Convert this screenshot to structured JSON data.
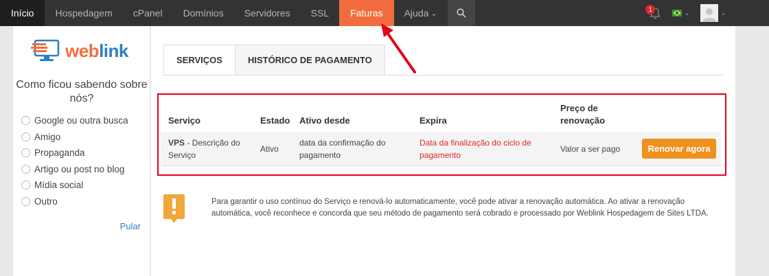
{
  "nav": {
    "items": [
      {
        "label": "Início",
        "state": "home"
      },
      {
        "label": "Hospedagem"
      },
      {
        "label": "cPanel"
      },
      {
        "label": "Domínios"
      },
      {
        "label": "Servidores"
      },
      {
        "label": "SSL"
      },
      {
        "label": "Faturas",
        "state": "active"
      },
      {
        "label": "Ajuda"
      }
    ],
    "notification_count": "1"
  },
  "sidebar": {
    "logo_prefix": "web",
    "logo_suffix": "link",
    "survey_title": "Como ficou sabendo sobre nós?",
    "options": [
      "Google ou outra busca",
      "Amigo",
      "Propaganda",
      "Artigo ou post no blog",
      "Mídia social",
      "Outro"
    ],
    "skip_label": "Pular"
  },
  "tabs": {
    "services": "SERVIÇOS",
    "payment_history": "HISTÓRICO DE PAGAMENTO"
  },
  "table": {
    "headers": {
      "service": "Serviço",
      "status": "Estado",
      "active_since": "Ativo desde",
      "expires": "Expira",
      "renewal_price": "Preço de renovação"
    },
    "row": {
      "service_name": "VPS",
      "service_desc": " - Descrição do Serviço",
      "status": "Ativo",
      "active_since": "data da confirmação do pagamento",
      "expires": "Data da finalização do ciclo de pagamento",
      "price": "Valor a ser pago",
      "renew_button": "Renovar agora"
    }
  },
  "notice": {
    "text": "Para garantir o uso contínuo do Serviço e renová-lo automaticamente, você pode ativar a renovação automática. Ao ativar a renovação automática, você reconhece e concorda que seu método de pagamento será cobrado e processado por Weblink Hospedagem de Sites LTDA."
  },
  "colors": {
    "nav_bg": "#333333",
    "active_tab": "#f26d3d",
    "highlight_border": "#e2001a",
    "renew_button": "#f0901e",
    "expiry_text": "#e0262b"
  }
}
